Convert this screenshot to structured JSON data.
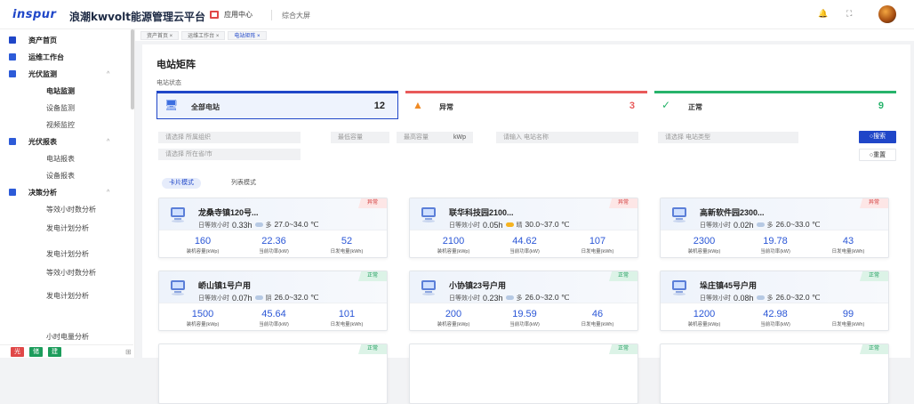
{
  "header": {
    "logo": "inspur",
    "title": "浪潮kwvolt能源管理云平台",
    "app_center": "应用中心",
    "big_screen": "综合大屏",
    "bell_icon": "bell-icon",
    "fullscreen_icon": "fullscreen-icon"
  },
  "sidebar": {
    "items": [
      {
        "label": "资产首页",
        "icon": "home-icon"
      },
      {
        "label": "运维工作台",
        "icon": "grid-icon"
      },
      {
        "label": "光伏监测",
        "icon": "pv-icon",
        "chev": "^"
      },
      {
        "label": "电站监测"
      },
      {
        "label": "设备监测"
      },
      {
        "label": "视频监控"
      },
      {
        "label": "光伏报表",
        "icon": "report-icon",
        "chev": "^"
      },
      {
        "label": "电站报表"
      },
      {
        "label": "设备报表"
      },
      {
        "label": "决策分析",
        "icon": "analysis-icon",
        "chev": "^"
      },
      {
        "label": "等效小时数分析"
      },
      {
        "label": "发电计划分析"
      },
      {
        "label": "发电计划分析"
      },
      {
        "label": "等效小时数分析"
      },
      {
        "label": "发电计划分析"
      },
      {
        "label": "小时电量分析"
      }
    ],
    "footer": {
      "badges": [
        "光",
        "储",
        "建"
      ],
      "badge_colors": [
        "#e04848",
        "#1c9c5b",
        "#1c9c5b"
      ],
      "menu_icon": "menu-icon"
    }
  },
  "tabs": [
    "资产首页 ×",
    "运维工作台 ×",
    "电站矩阵 ×"
  ],
  "main": {
    "title": "电站矩阵",
    "status_label": "电站状态",
    "stats": [
      {
        "label": "全部电站",
        "count": "12",
        "color": "#1f46c8",
        "icon": "station-icon"
      },
      {
        "label": "异常",
        "count": "3",
        "color": "#e85a5a",
        "icon": "warning-icon"
      },
      {
        "label": "正常",
        "count": "9",
        "color": "#27b36b",
        "icon": "check-icon"
      }
    ],
    "filters": {
      "org_placeholder": "请选择 所属组织",
      "min_cap": "最低容量",
      "max_cap": "最高容量",
      "unit": "kWp",
      "name_placeholder": "请输入 电站名称",
      "type_placeholder": "请选择 电站类型",
      "region_placeholder": "请选择 所在省/市",
      "search": "○搜索",
      "reset": "○重置"
    },
    "modes": {
      "card": "卡片模式",
      "list": "列表模式"
    },
    "cards": [
      {
        "name": "龙桑寺镇120号...",
        "status": "异常",
        "state": "err",
        "hours": "0.33h",
        "weather": "多",
        "temp": "27.0~34.0 ℃",
        "capacity": "160",
        "power": "22.36",
        "energy": "52"
      },
      {
        "name": "联华科技园2100...",
        "status": "异常",
        "state": "err",
        "hours": "0.05h",
        "weather": "晴",
        "temp": "30.0~37.0 ℃",
        "capacity": "2100",
        "power": "44.62",
        "energy": "107"
      },
      {
        "name": "高新软件园2300...",
        "status": "异常",
        "state": "err",
        "hours": "0.02h",
        "weather": "多",
        "temp": "26.0~33.0 ℃",
        "capacity": "2300",
        "power": "19.78",
        "energy": "43"
      },
      {
        "name": "峤山镇1号户用",
        "status": "正常",
        "state": "ok",
        "hours": "0.07h",
        "weather": "阴",
        "temp": "26.0~32.0 ℃",
        "capacity": "1500",
        "power": "45.64",
        "energy": "101"
      },
      {
        "name": "小协镇23号户用",
        "status": "正常",
        "state": "ok",
        "hours": "0.23h",
        "weather": "多",
        "temp": "26.0~32.0 ℃",
        "capacity": "200",
        "power": "19.59",
        "energy": "46"
      },
      {
        "name": "垛庄镇45号户用",
        "status": "正常",
        "state": "ok",
        "hours": "0.08h",
        "weather": "多",
        "temp": "26.0~32.0 ℃",
        "capacity": "1200",
        "power": "42.98",
        "energy": "99"
      }
    ],
    "labels": {
      "hours_prefix": "日等效小时",
      "capacity": "装机容量(kWp)",
      "power": "当前功率(kW)",
      "energy": "日发电量(kWh)"
    },
    "more_cards_status": [
      "正常",
      "正常",
      "正常"
    ]
  }
}
